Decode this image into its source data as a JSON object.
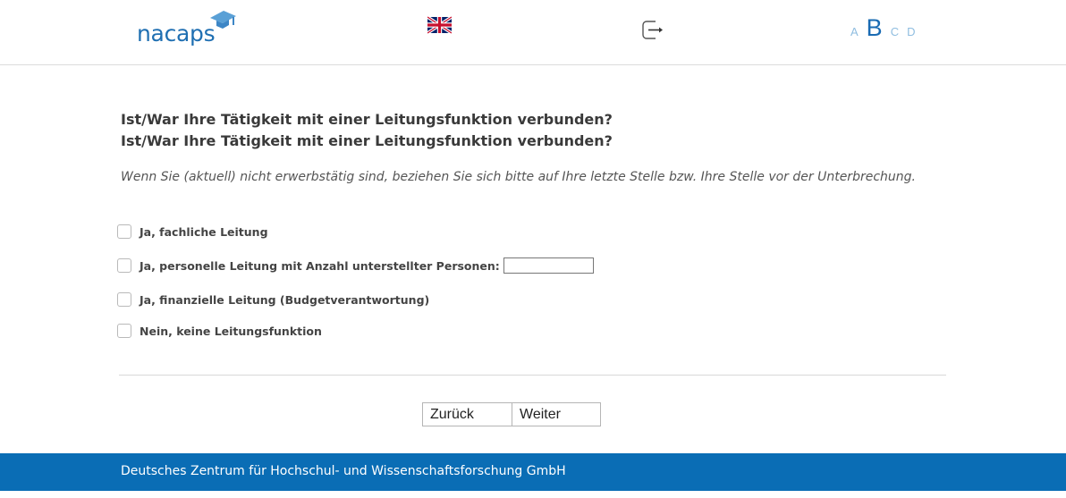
{
  "header": {
    "logo_text": "nacaps",
    "language_flag": "uk-flag-icon",
    "logout_icon": "logout-icon",
    "font_sizes": [
      {
        "label": "A",
        "active": false
      },
      {
        "label": "B",
        "active": true
      },
      {
        "label": "C",
        "active": false
      },
      {
        "label": "D",
        "active": false
      }
    ]
  },
  "question": {
    "line1": "Ist/War Ihre Tätigkeit mit einer Leitungsfunktion verbunden?",
    "line2": "Ist/War Ihre Tätigkeit mit einer Leitungsfunktion verbunden?",
    "hint": "Wenn Sie (aktuell) nicht erwerbstätig sind, beziehen Sie sich bitte auf Ihre letzte Stelle bzw. Ihre Stelle vor der Unterbrechung."
  },
  "options": [
    {
      "label": "Ja, fachliche Leitung",
      "checked": false
    },
    {
      "label": "Ja, personelle Leitung mit Anzahl unterstellter Personen:",
      "checked": false,
      "input_value": ""
    },
    {
      "label": "Ja, finanzielle Leitung (Budgetverantwortung)",
      "checked": false
    },
    {
      "label": "Nein, keine Leitungsfunktion",
      "checked": false
    }
  ],
  "nav": {
    "back_label": "Zurück",
    "next_label": "Weiter"
  },
  "footer": {
    "text": "Deutsches Zentrum für Hochschul- und Wissenschaftsforschung GmbH"
  },
  "colors": {
    "brand": "#1f6fb2",
    "footer_bg": "#0a6db5",
    "font_switch_inactive": "#8fbde0"
  }
}
